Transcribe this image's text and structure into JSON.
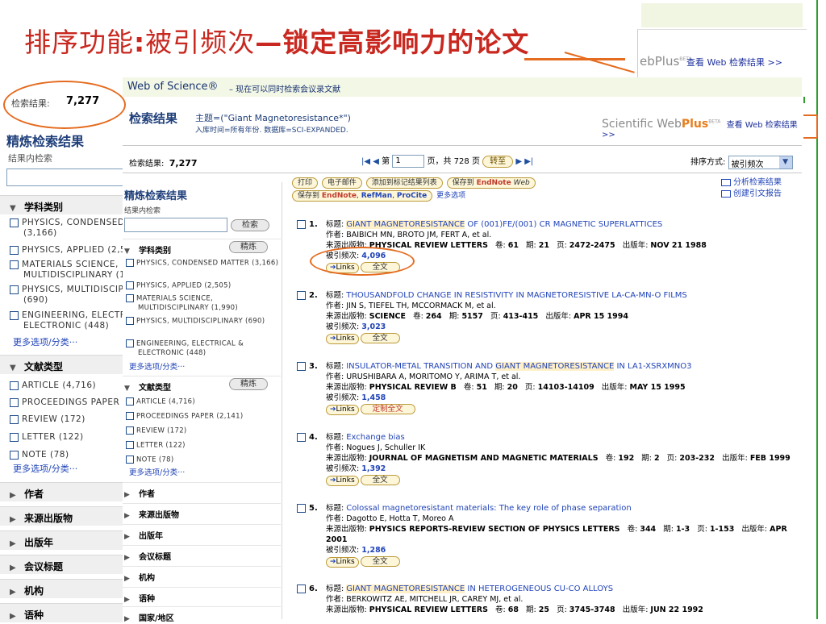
{
  "slide": {
    "title_regular": "排序功能",
    "title_bold_colon": ":",
    "title_part2": "被引频次",
    "title_bold_rest": "—锁定高影响力的论文"
  },
  "webplus": {
    "brand_prefix": "Scientific Web",
    "brand_suffix": "Plus",
    "brand_beta": "BETA",
    "brand_partial": "ebPlus",
    "link": "查看 Web 检索结果 >>"
  },
  "bg_left": {
    "count_label": "检索结果:",
    "count": "7,277",
    "refine_title": "精炼检索结果",
    "within": "结果内检索",
    "sections": [
      {
        "label": "学科类别"
      },
      {
        "label": "文献类型"
      },
      {
        "label": "作者"
      },
      {
        "label": "来源出版物"
      },
      {
        "label": "出版年"
      },
      {
        "label": "会议标题"
      },
      {
        "label": "机构"
      },
      {
        "label": "语种"
      }
    ],
    "subjects": [
      {
        "label": "PHYSICS, CONDENSED",
        "count": "(3,166)"
      },
      {
        "label": "PHYSICS, APPLIED (2,5"
      },
      {
        "label": "MATERIALS SCIENCE,",
        "count": "MULTIDISCIPLINARY (1"
      },
      {
        "label": "PHYSICS, MULTIDISCIP",
        "count": "(690)"
      },
      {
        "label": "ENGINEERING, ELECTF",
        "count": "ELECTRONIC (448)"
      }
    ],
    "doctypes": [
      {
        "label": "ARTICLE (4,716)"
      },
      {
        "label": "PROCEEDINGS PAPER"
      },
      {
        "label": "REVIEW (172)"
      },
      {
        "label": "LETTER (122)"
      },
      {
        "label": "NOTE (78)"
      }
    ],
    "more": "更多选项/分类···"
  },
  "wos": {
    "title": "Web of Science®",
    "subtitle": "– 现在可以同时检索会议录文献",
    "results_heading": "检索结果",
    "topic": "主题=(\"Giant Magnetoresistance*\")",
    "topic2": "入库时间=所有年份. 数据库=SCI-EXPANDED.",
    "count_label": "检索结果:",
    "count": "7,277",
    "pager": {
      "prev": "|◀ ◀",
      "page_label": "第",
      "page_value": "1",
      "page_suffix": "页，共 728 页",
      "go": "转至",
      "next": "▶ ▶|"
    },
    "sort_label": "排序方式:",
    "sort_value": "被引频次",
    "toolbar": {
      "print": "打印",
      "email": "电子邮件",
      "add_marked": "添加到标记结果列表",
      "save_to": "保存到",
      "endnote": "EndNote",
      "web": "Web",
      "save_to2": "保存到",
      "endnote2": "EndNote",
      "refman": "RefMan",
      "procite": "ProCite",
      "more": "更多选项",
      "analyze": "分析检索结果",
      "citation_report": "创建引文报告"
    }
  },
  "inner_left": {
    "title": "精炼检索结果",
    "within": "结果内检索",
    "search_btn": "检索",
    "refine_btn": "精炼",
    "sections": [
      {
        "label": "学科类别"
      },
      {
        "label": "文献类型"
      },
      {
        "label": "作者"
      },
      {
        "label": "来源出版物"
      },
      {
        "label": "出版年"
      },
      {
        "label": "会议标题"
      },
      {
        "label": "机构"
      },
      {
        "label": "语种"
      },
      {
        "label": "国家/地区"
      }
    ],
    "subjects": [
      {
        "label": "PHYSICS, CONDENSED MATTER (3,166)"
      },
      {
        "label": "PHYSICS, APPLIED (2,505)"
      },
      {
        "label": "MATERIALS SCIENCE, MULTIDISCIPLINARY (1,990)"
      },
      {
        "label": "PHYSICS, MULTIDISCIPLINARY (690)"
      },
      {
        "label": "ENGINEERING, ELECTRICAL & ELECTRONIC (448)"
      }
    ],
    "doctypes": [
      {
        "label": "ARTICLE (4,716)"
      },
      {
        "label": "PROCEEDINGS PAPER (2,141)"
      },
      {
        "label": "REVIEW (172)"
      },
      {
        "label": "LETTER (122)"
      },
      {
        "label": "NOTE (78)"
      }
    ],
    "more": "更多选项/分类···"
  },
  "labels": {
    "title": "标题:",
    "authors": "作者:",
    "source": "来源出版物:",
    "volume": "卷:",
    "issue": "期:",
    "pages": "页:",
    "year": "出版年:",
    "cited": "被引频次:",
    "links": "Links",
    "fulltext": "全文",
    "custom_fulltext": "定制全文"
  },
  "records": [
    {
      "num": "1.",
      "title_hl": "GIANT MAGNETORESISTANCE",
      "title_rest": " OF (001)FE/(001) CR MAGNETIC SUPERLATTICES",
      "title_pre": "",
      "authors": "BAIBICH MN, BROTO JM, FERT A, et al.",
      "source": "PHYSICAL REVIEW LETTERS",
      "volume": "61",
      "issue": "21",
      "pages": "2472-2475",
      "year": "NOV 21 1988",
      "cited": "4,096",
      "button": "全文"
    },
    {
      "num": "2.",
      "title_pre": "THOUSANDFOLD CHANGE IN RESISTIVITY IN MAGNETORESISTIVE LA-CA-MN-O FILMS",
      "title_hl": "",
      "title_rest": "",
      "authors": "JIN S, TIEFEL TH, MCCORMACK M, et al.",
      "source": "SCIENCE",
      "volume": "264",
      "issue": "5157",
      "pages": "413-415",
      "year": "APR 15 1994",
      "cited": "3,023",
      "button": "全文"
    },
    {
      "num": "3.",
      "title_pre": "INSULATOR-METAL TRANSITION AND ",
      "title_hl": "GIANT MAGNETORESISTANCE",
      "title_rest": " IN LA1-XSRXMNO3",
      "authors": "URUSHIBARA A, MORITOMO Y, ARIMA T, et al.",
      "source": "PHYSICAL REVIEW B",
      "volume": "51",
      "issue": "20",
      "pages": "14103-14109",
      "year": "MAY 15 1995",
      "cited": "1,458",
      "button": "定制全文"
    },
    {
      "num": "4.",
      "title_pre": "Exchange bias",
      "title_hl": "",
      "title_rest": "",
      "authors": "Nogues J, Schuller IK",
      "source": "JOURNAL OF MAGNETISM AND MAGNETIC MATERIALS",
      "volume": "192",
      "issue": "2",
      "pages": "203-232",
      "year": "FEB 1999",
      "cited": "1,392",
      "button": "全文"
    },
    {
      "num": "5.",
      "title_pre": "Colossal magnetoresistant materials: The key role of phase separation",
      "title_hl": "",
      "title_rest": "",
      "authors": "Dagotto E, Hotta T, Moreo A",
      "source": "PHYSICS REPORTS-REVIEW SECTION OF PHYSICS LETTERS",
      "volume": "344",
      "issue": "1-3",
      "pages": "1-153",
      "year": "APR 2001",
      "cited": "1,286",
      "button": "全文"
    },
    {
      "num": "6.",
      "title_pre": "",
      "title_hl": "GIANT MAGNETORESISTANCE",
      "title_rest": " IN HETEROGENEOUS CU-CO ALLOYS",
      "authors": "BERKOWITZ AE, MITCHELL JR, CAREY MJ, et al.",
      "source": "PHYSICAL REVIEW LETTERS",
      "volume": "68",
      "issue": "25",
      "pages": "3745-3748",
      "year": "JUN 22 1992",
      "cited": "",
      "button": ""
    }
  ],
  "colors": {
    "title_red": "#c8281f",
    "annotation_orange": "#e56b1f",
    "link_blue": "#2144b8",
    "heading_navy": "#1f3f7a"
  }
}
